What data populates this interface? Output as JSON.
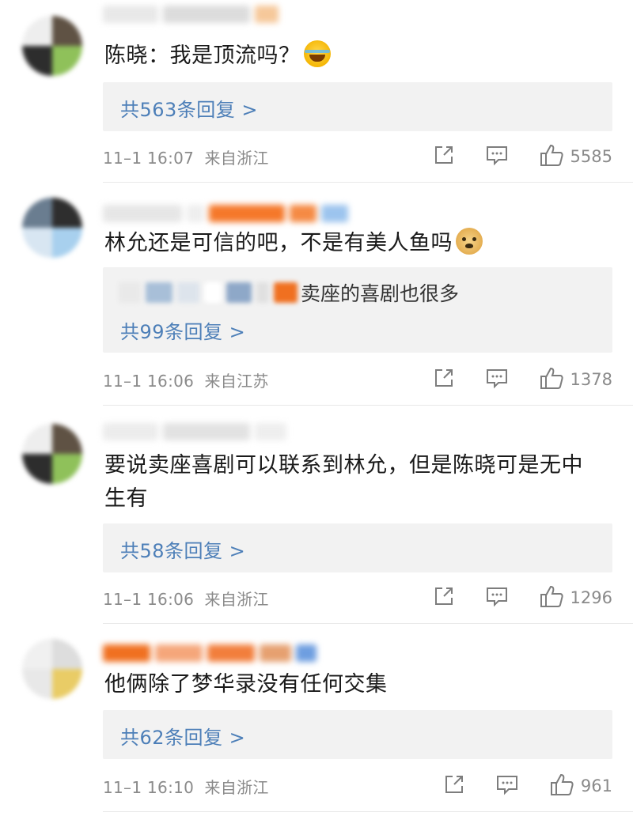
{
  "comments": [
    {
      "text": "陈晓：我是顶流吗？",
      "emoji": "laughing-tears-emoji",
      "reply_link": "共563条回复 >",
      "time": "11–1 16:07",
      "location": "来自浙江",
      "likes": "5585"
    },
    {
      "text": "林允还是可信的吧，不是有美人鱼吗",
      "emoji": "doge-emoji",
      "quote_text": "卖座的喜剧也很多",
      "reply_link": "共99条回复 >",
      "time": "11–1 16:06",
      "location": "来自江苏",
      "likes": "1378"
    },
    {
      "text_line1": "要说卖座喜剧可以联系到林允，但是陈晓可是无中",
      "text_line2": "生有",
      "reply_link": "共58条回复 >",
      "time": "11–1 16:06",
      "location": "来自浙江",
      "likes": "1296"
    },
    {
      "text": "他俩除了梦华录没有任何交集",
      "reply_link": "共62条回复 >",
      "time": "11–1 16:10",
      "location": "来自浙江",
      "likes": "961"
    }
  ],
  "colors": {
    "link": "#4d7fb8",
    "meta": "#8a8a8a",
    "reply_bg": "#f2f2f2"
  },
  "icons": [
    "share-icon",
    "comment-icon",
    "like-icon"
  ]
}
